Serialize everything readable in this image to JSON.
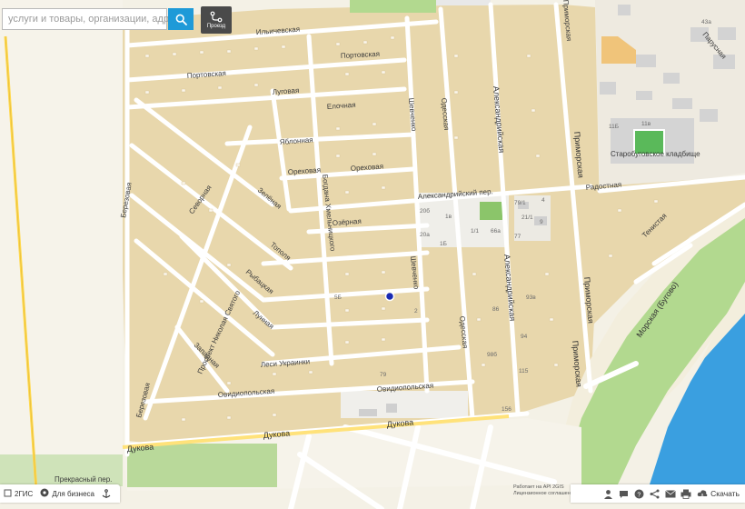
{
  "search": {
    "placeholder": "услуги и товары, организации, адреса",
    "button_icon": "search-icon"
  },
  "route": {
    "label": "Проезд",
    "icon": "route-icon"
  },
  "streets": {
    "ilichevskaya": "Ильичевская",
    "portovskaya_1": "Портовская",
    "portovskaya_2": "Портовская",
    "lugovaya": "Луговая",
    "elochnaya": "Елочная",
    "yablonnaya": "Яблонная",
    "orehovaya_1": "Ореховая",
    "orehovaya_2": "Ореховая",
    "alexandriyskiy_per": "Александрийский пер.",
    "sevornaya": "Севорная",
    "zelenaya": "Зелёная",
    "berezovaya": "Березовая",
    "ozernaya": "Озёрная",
    "bogdana": "Богдана Хмельницкого",
    "shevchenko_1": "Шевченко",
    "shevchenko_2": "Шевченко",
    "odesskaya_1": "Одесская",
    "odesskaya_2": "Одесская",
    "alexandriyskaya_1": "Александрийская",
    "alexandriyskaya_2": "Александрийская",
    "primorskaya_top": "Приморская",
    "primorskaya_1": "Приморская",
    "primorskaya_2": "Приморская",
    "primorskaya_3": "Приморская",
    "parusnaya": "Парусная",
    "radostnaya": "Радостная",
    "tenistaya": "Тенистая",
    "morskaya": "Морская (Бугово)",
    "topolya": "Тополя",
    "rybatskaya": "Рыбацкая",
    "lunnaya": "Лунная",
    "nikolaya": "Проспект Николая Святого",
    "zapadnaya": "Западная",
    "lesi": "Леси Украинки",
    "ovidiopolskaya_1": "Овидиопольская",
    "ovidiopolskaya_2": "Овидиопольская",
    "berezovaya_2": "Березовая",
    "dukova_1": "Дукова",
    "dukova_2": "Дукова",
    "dukova_3": "Дукова",
    "prekrasnyi": "Прекрасный пер."
  },
  "places": {
    "cemetery": "Старобуговское кладбище"
  },
  "numbers": [
    "43а",
    "11Б",
    "11в",
    "79/1",
    "21/1",
    "20б",
    "1в",
    "1/1",
    "66а",
    "20а",
    "1Б",
    "77",
    "4",
    "9",
    "5Б",
    "2",
    "86",
    "93в",
    "98б",
    "94",
    "115",
    "156",
    "79",
    "2",
    "3",
    "5",
    "11",
    "7",
    "73",
    "16"
  ],
  "bottom": {
    "twogis": "2ГИС",
    "business": "Для бизнеса",
    "download": "Скачать",
    "copyright_1": "Работает на API 2GIS",
    "copyright_2": "Лицензионное соглашение"
  },
  "colors": {
    "land": "#f4f1e6",
    "block": "#e8d7ac",
    "road": "#ffffff",
    "water": "#3a9fe0",
    "sand": "#f3eedd",
    "park": "#b2d98f",
    "accent": "#1e9ad8",
    "highway": "#ffd84d"
  }
}
